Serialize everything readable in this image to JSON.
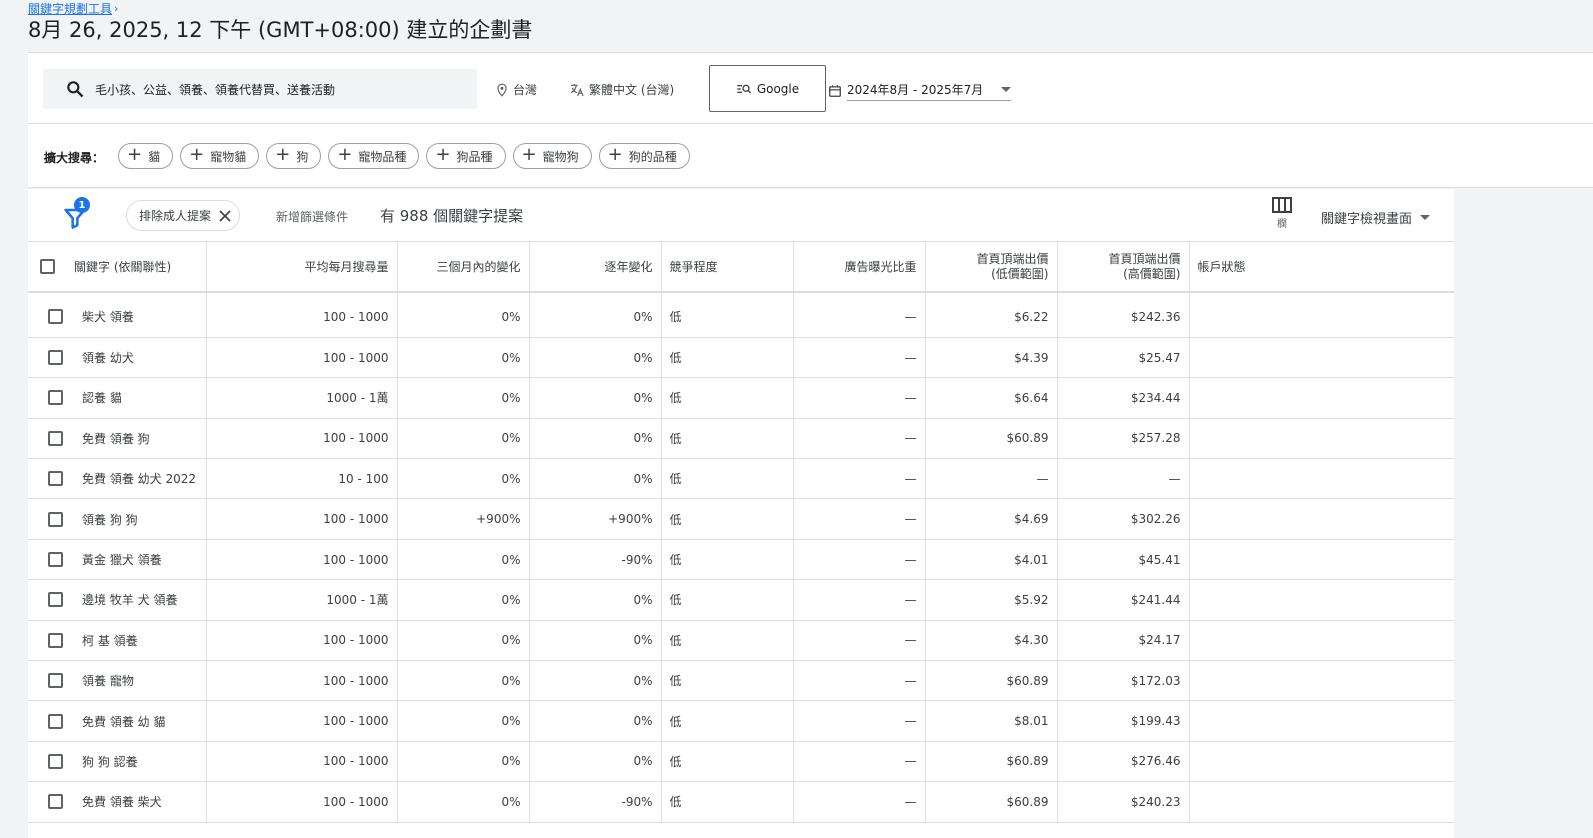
{
  "breadcrumb": {
    "tool": "關鍵字規劃工具"
  },
  "page_title": "8月 26, 2025, 12 下午 (GMT+08:00) 建立的企劃書",
  "search": {
    "query": "毛小孩、公益、領養、領養代替買、送養活動"
  },
  "location": "台灣",
  "language": "繁體中文 (台灣)",
  "network": "Google",
  "date_range": "2024年8月 - 2025年7月",
  "broaden": {
    "label": "擴大搜尋：",
    "chips": [
      "貓",
      "寵物貓",
      "狗",
      "寵物品種",
      "狗品種",
      "寵物狗",
      "狗的品種"
    ]
  },
  "filters": {
    "badge_count": "1",
    "active_filter": "排除成人提案",
    "add_filter": "新增篩選條件",
    "result_count": "有 988 個關鍵字提案"
  },
  "toolbar": {
    "columns_label": "欄",
    "view_label": "關鍵字檢視畫面"
  },
  "table": {
    "headers": {
      "keyword": "關鍵字 (依關聯性)",
      "avg_monthly": "平均每月搜尋量",
      "three_month": "三個月內的變化",
      "yoy": "逐年變化",
      "competition": "競爭程度",
      "impression_share": "廣告曝光比重",
      "bid_low_1": "首頁頂端出價",
      "bid_low_2": "(低價範圍)",
      "bid_high_1": "首頁頂端出價",
      "bid_high_2": "(高價範圍)",
      "account_status": "帳戶狀態"
    },
    "rows": [
      {
        "keyword": "柴犬 領養",
        "avg": "100 - 1000",
        "three": "0%",
        "yoy": "0%",
        "comp": "低",
        "share": "—",
        "low": "$6.22",
        "high": "$242.36"
      },
      {
        "keyword": "領養 幼犬",
        "avg": "100 - 1000",
        "three": "0%",
        "yoy": "0%",
        "comp": "低",
        "share": "—",
        "low": "$4.39",
        "high": "$25.47"
      },
      {
        "keyword": "認養 貓",
        "avg": "1000 - 1萬",
        "three": "0%",
        "yoy": "0%",
        "comp": "低",
        "share": "—",
        "low": "$6.64",
        "high": "$234.44"
      },
      {
        "keyword": "免費 領養 狗",
        "avg": "100 - 1000",
        "three": "0%",
        "yoy": "0%",
        "comp": "低",
        "share": "—",
        "low": "$60.89",
        "high": "$257.28"
      },
      {
        "keyword": "免費 領養 幼犬 2022",
        "avg": "10 - 100",
        "three": "0%",
        "yoy": "0%",
        "comp": "低",
        "share": "—",
        "low": "—",
        "high": "—"
      },
      {
        "keyword": "領養 狗 狗",
        "avg": "100 - 1000",
        "three": "+900%",
        "yoy": "+900%",
        "comp": "低",
        "share": "—",
        "low": "$4.69",
        "high": "$302.26"
      },
      {
        "keyword": "黃金 獵犬 領養",
        "avg": "100 - 1000",
        "three": "0%",
        "yoy": "-90%",
        "comp": "低",
        "share": "—",
        "low": "$4.01",
        "high": "$45.41"
      },
      {
        "keyword": "邊境 牧羊 犬 領養",
        "avg": "1000 - 1萬",
        "three": "0%",
        "yoy": "0%",
        "comp": "低",
        "share": "—",
        "low": "$5.92",
        "high": "$241.44"
      },
      {
        "keyword": "柯 基 領養",
        "avg": "100 - 1000",
        "three": "0%",
        "yoy": "0%",
        "comp": "低",
        "share": "—",
        "low": "$4.30",
        "high": "$24.17"
      },
      {
        "keyword": "領養 寵物",
        "avg": "100 - 1000",
        "three": "0%",
        "yoy": "0%",
        "comp": "低",
        "share": "—",
        "low": "$60.89",
        "high": "$172.03"
      },
      {
        "keyword": "免費 領養 幼 貓",
        "avg": "100 - 1000",
        "three": "0%",
        "yoy": "0%",
        "comp": "低",
        "share": "—",
        "low": "$8.01",
        "high": "$199.43"
      },
      {
        "keyword": "狗 狗 認養",
        "avg": "100 - 1000",
        "three": "0%",
        "yoy": "0%",
        "comp": "低",
        "share": "—",
        "low": "$60.89",
        "high": "$276.46"
      },
      {
        "keyword": "免費 領養 柴犬",
        "avg": "100 - 1000",
        "three": "0%",
        "yoy": "-90%",
        "comp": "低",
        "share": "—",
        "low": "$60.89",
        "high": "$240.23"
      }
    ]
  }
}
